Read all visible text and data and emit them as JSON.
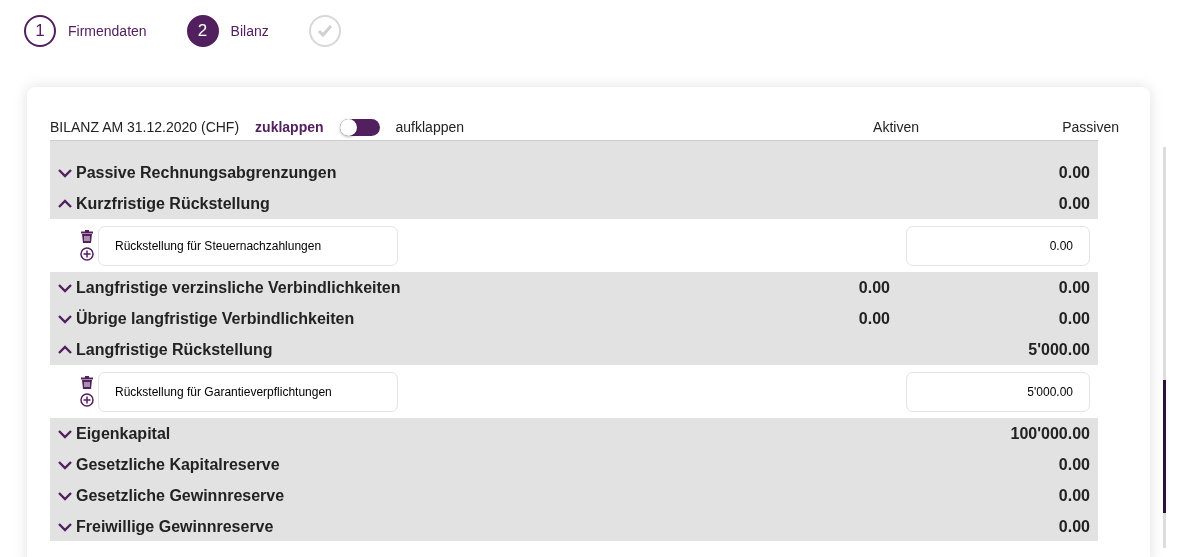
{
  "steps": [
    {
      "number": "1",
      "label": "Firmendaten",
      "selected": false
    },
    {
      "number": "2",
      "label": "Bilanz",
      "selected": true
    },
    {
      "selected": false
    }
  ],
  "header": {
    "title": "BILANZ AM 31.12.2020 (CHF)",
    "toggle": {
      "left_label": "zuklappen",
      "right_label": "aufklappen",
      "expanded": false
    },
    "columns": [
      "Aktiven",
      "Passiven"
    ]
  },
  "rows": [
    {
      "label": "Passive Rechnungsabgrenzungen",
      "passiven": "0.00",
      "expanded": false
    },
    {
      "label": "Kurzfristige Rückstellung",
      "passiven": "0.00",
      "expanded": true,
      "items": [
        {
          "label": "Rückstellung für Steuernachzahlungen",
          "passiven": "0.00"
        }
      ]
    },
    {
      "label": "Langfristige verzinsliche Verbindlichkeiten",
      "aktiven": "0.00",
      "passiven": "0.00",
      "expanded": false
    },
    {
      "label": "Übrige langfristige Verbindlichkeiten",
      "aktiven": "0.00",
      "passiven": "0.00",
      "expanded": false
    },
    {
      "label": "Langfristige Rückstellung",
      "passiven": "5'000.00",
      "expanded": true,
      "items": [
        {
          "label": "Rückstellung für Garantieverpflichtungen",
          "passiven": "5'000.00"
        }
      ]
    },
    {
      "label": "Eigenkapital",
      "passiven": "100'000.00",
      "expanded": false
    },
    {
      "label": "Gesetzliche Kapitalreserve",
      "passiven": "0.00",
      "expanded": false
    },
    {
      "label": "Gesetzliche Gewinnreserve",
      "passiven": "0.00",
      "expanded": false
    },
    {
      "label": "Freiwillige Gewinnreserve",
      "passiven": "0.00",
      "expanded": false
    }
  ]
}
